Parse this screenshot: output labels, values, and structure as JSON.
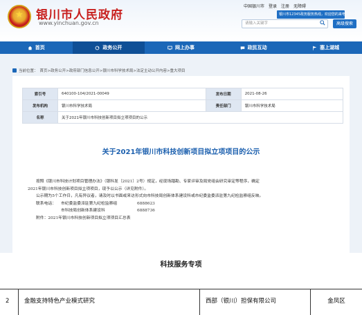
{
  "header": {
    "title": "银川市人民政府",
    "url": "www.yinchuan.gov.cn",
    "top_links": [
      "中国银川市",
      "登录",
      "注册",
      "无障碍"
    ],
    "notice": "银川市12345政务服务热线，欢迎您的来电",
    "search_placeholder": "请输入关键字",
    "advanced_search": "高级搜索"
  },
  "nav": [
    {
      "label": "首页",
      "icon": "home-icon",
      "active": false
    },
    {
      "label": "政务公开",
      "icon": "refresh-icon",
      "active": true
    },
    {
      "label": "网上办事",
      "icon": "screen-icon",
      "active": false
    },
    {
      "label": "政民互动",
      "icon": "chat-icon",
      "active": false
    },
    {
      "label": "塞上湖城",
      "icon": "flag-icon",
      "active": false
    }
  ],
  "breadcrumb": {
    "prefix": "当前位置：",
    "path": "首页>政务公开>政府部门信息公开>银川市科学技术局>法定主动公开内容>重大项目"
  },
  "meta": {
    "index_label": "索引号",
    "index_value": "640100-104/2021-00049",
    "date_label": "发布日期",
    "date_value": "2021-08-26",
    "org_label": "发布机构",
    "org_value": "银川市科学技术局",
    "dept_label": "责任部门",
    "dept_value": "银川市科学技术局",
    "name_label": "名称",
    "name_value": "关于2021年银川市科技创新项目拟立项项目的公示"
  },
  "doc": {
    "title": "关于2021年银川市科技创新项目拟立项项目的公示",
    "para1_line1": "按照《银川市科技计划项目管理办法》（银科发〔2021〕2号）规定，经现场踏勘、专家评审及局党组会研究审定等程序，确定",
    "para1_line2": "2021年银川市科技创新项目拟立项项目，现予以公示（详见附件）。",
    "para2": "公示期为5个工作日，凡有异议者，请及时以书面或来访形式向市科技局创新体系建设科或市纪委监委派驻第九纪检监察组反映。",
    "contact_label": "联系电话：",
    "contact1_dept": "市纪委监委派驻第九纪检监察组",
    "contact1_phone": "6888623",
    "contact2_dept": "市科技局创新体系建设科",
    "contact2_phone": "6888736",
    "attachment": "附件：2021年银川市科技创新项目拟立项项目汇总表"
  },
  "section": {
    "title": "科技服务专项"
  },
  "table_row": {
    "index": "2",
    "project": "金融支持特色产业模式研究",
    "company": "西部（银川）担保有限公司",
    "district": "金凤区"
  },
  "colors": {
    "brand_red": "#c8201e",
    "nav_blue": "#1b67b8",
    "title_blue": "#1b5fae"
  }
}
